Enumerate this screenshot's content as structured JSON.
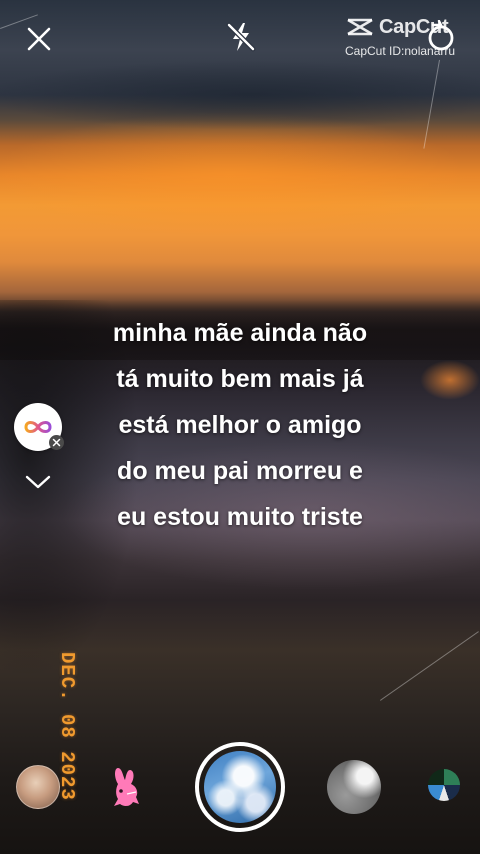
{
  "watermark": {
    "brand": "CapCut",
    "id_line": "CapCut ID:nolanarru"
  },
  "top_controls": {
    "close_icon": "close-icon",
    "flash_icon": "flash-off-icon",
    "switch_icon": "camera-switch-icon"
  },
  "caption": {
    "lines": [
      "minha mãe ainda não",
      "tá muito bem mais já",
      "está melhor o amigo",
      "do meu pai morreu e",
      "eu estou muito triste"
    ]
  },
  "side_controls": {
    "mode_icon": "infinity-icon",
    "mode_color": "#e0578a",
    "clear_icon": "close-icon",
    "collapse_icon": "chevron-down-icon"
  },
  "date_stamp": "DEC. 08 2023",
  "bottom_bar": {
    "bunny_color": "#ff7ab8",
    "items": [
      "thumbnail-photo",
      "bunny-icon",
      "shutter-button",
      "thumbnail-gray",
      "thumbnail-small"
    ]
  },
  "colors": {
    "sky_orange": "#f39a34",
    "date_orange": "#f09a2e",
    "text": "#ffffff"
  }
}
